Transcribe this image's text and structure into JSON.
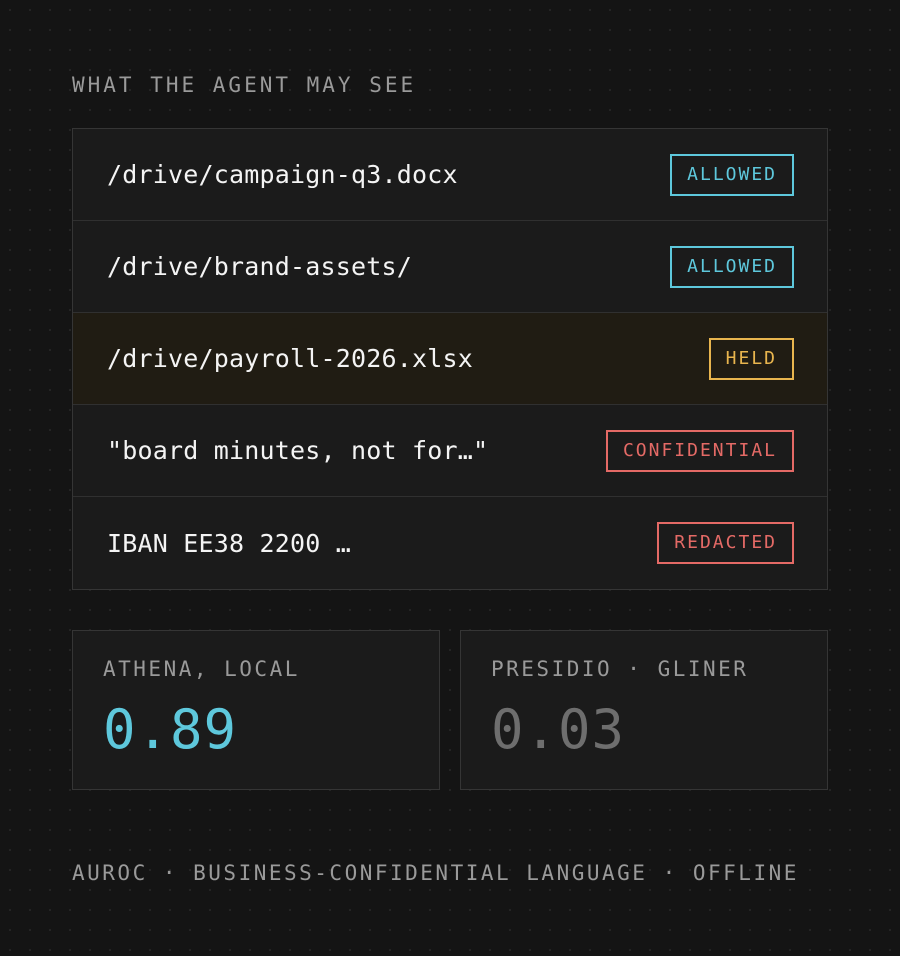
{
  "section_title": "WHAT THE AGENT MAY SEE",
  "items": [
    {
      "path": "/drive/campaign-q3.docx",
      "status": "ALLOWED"
    },
    {
      "path": "/drive/brand-assets/",
      "status": "ALLOWED"
    },
    {
      "path": "/drive/payroll-2026.xlsx",
      "status": "HELD"
    },
    {
      "path": "\"board minutes, not for…\"",
      "status": "CONFIDENTIAL"
    },
    {
      "path": "IBAN EE38 2200 …",
      "status": "REDACTED"
    }
  ],
  "scores": [
    {
      "label": "ATHENA, LOCAL",
      "value": "0.89"
    },
    {
      "label": "PRESIDIO · GLINER",
      "value": "0.03"
    }
  ],
  "footer": "AUROC · BUSINESS-CONFIDENTIAL LANGUAGE · OFFLINE",
  "colors": {
    "background": "#141414",
    "allowed": "#5ec8dc",
    "held": "#e8b54e",
    "blocked": "#e46a66",
    "muted_score": "#6e6e6e"
  }
}
